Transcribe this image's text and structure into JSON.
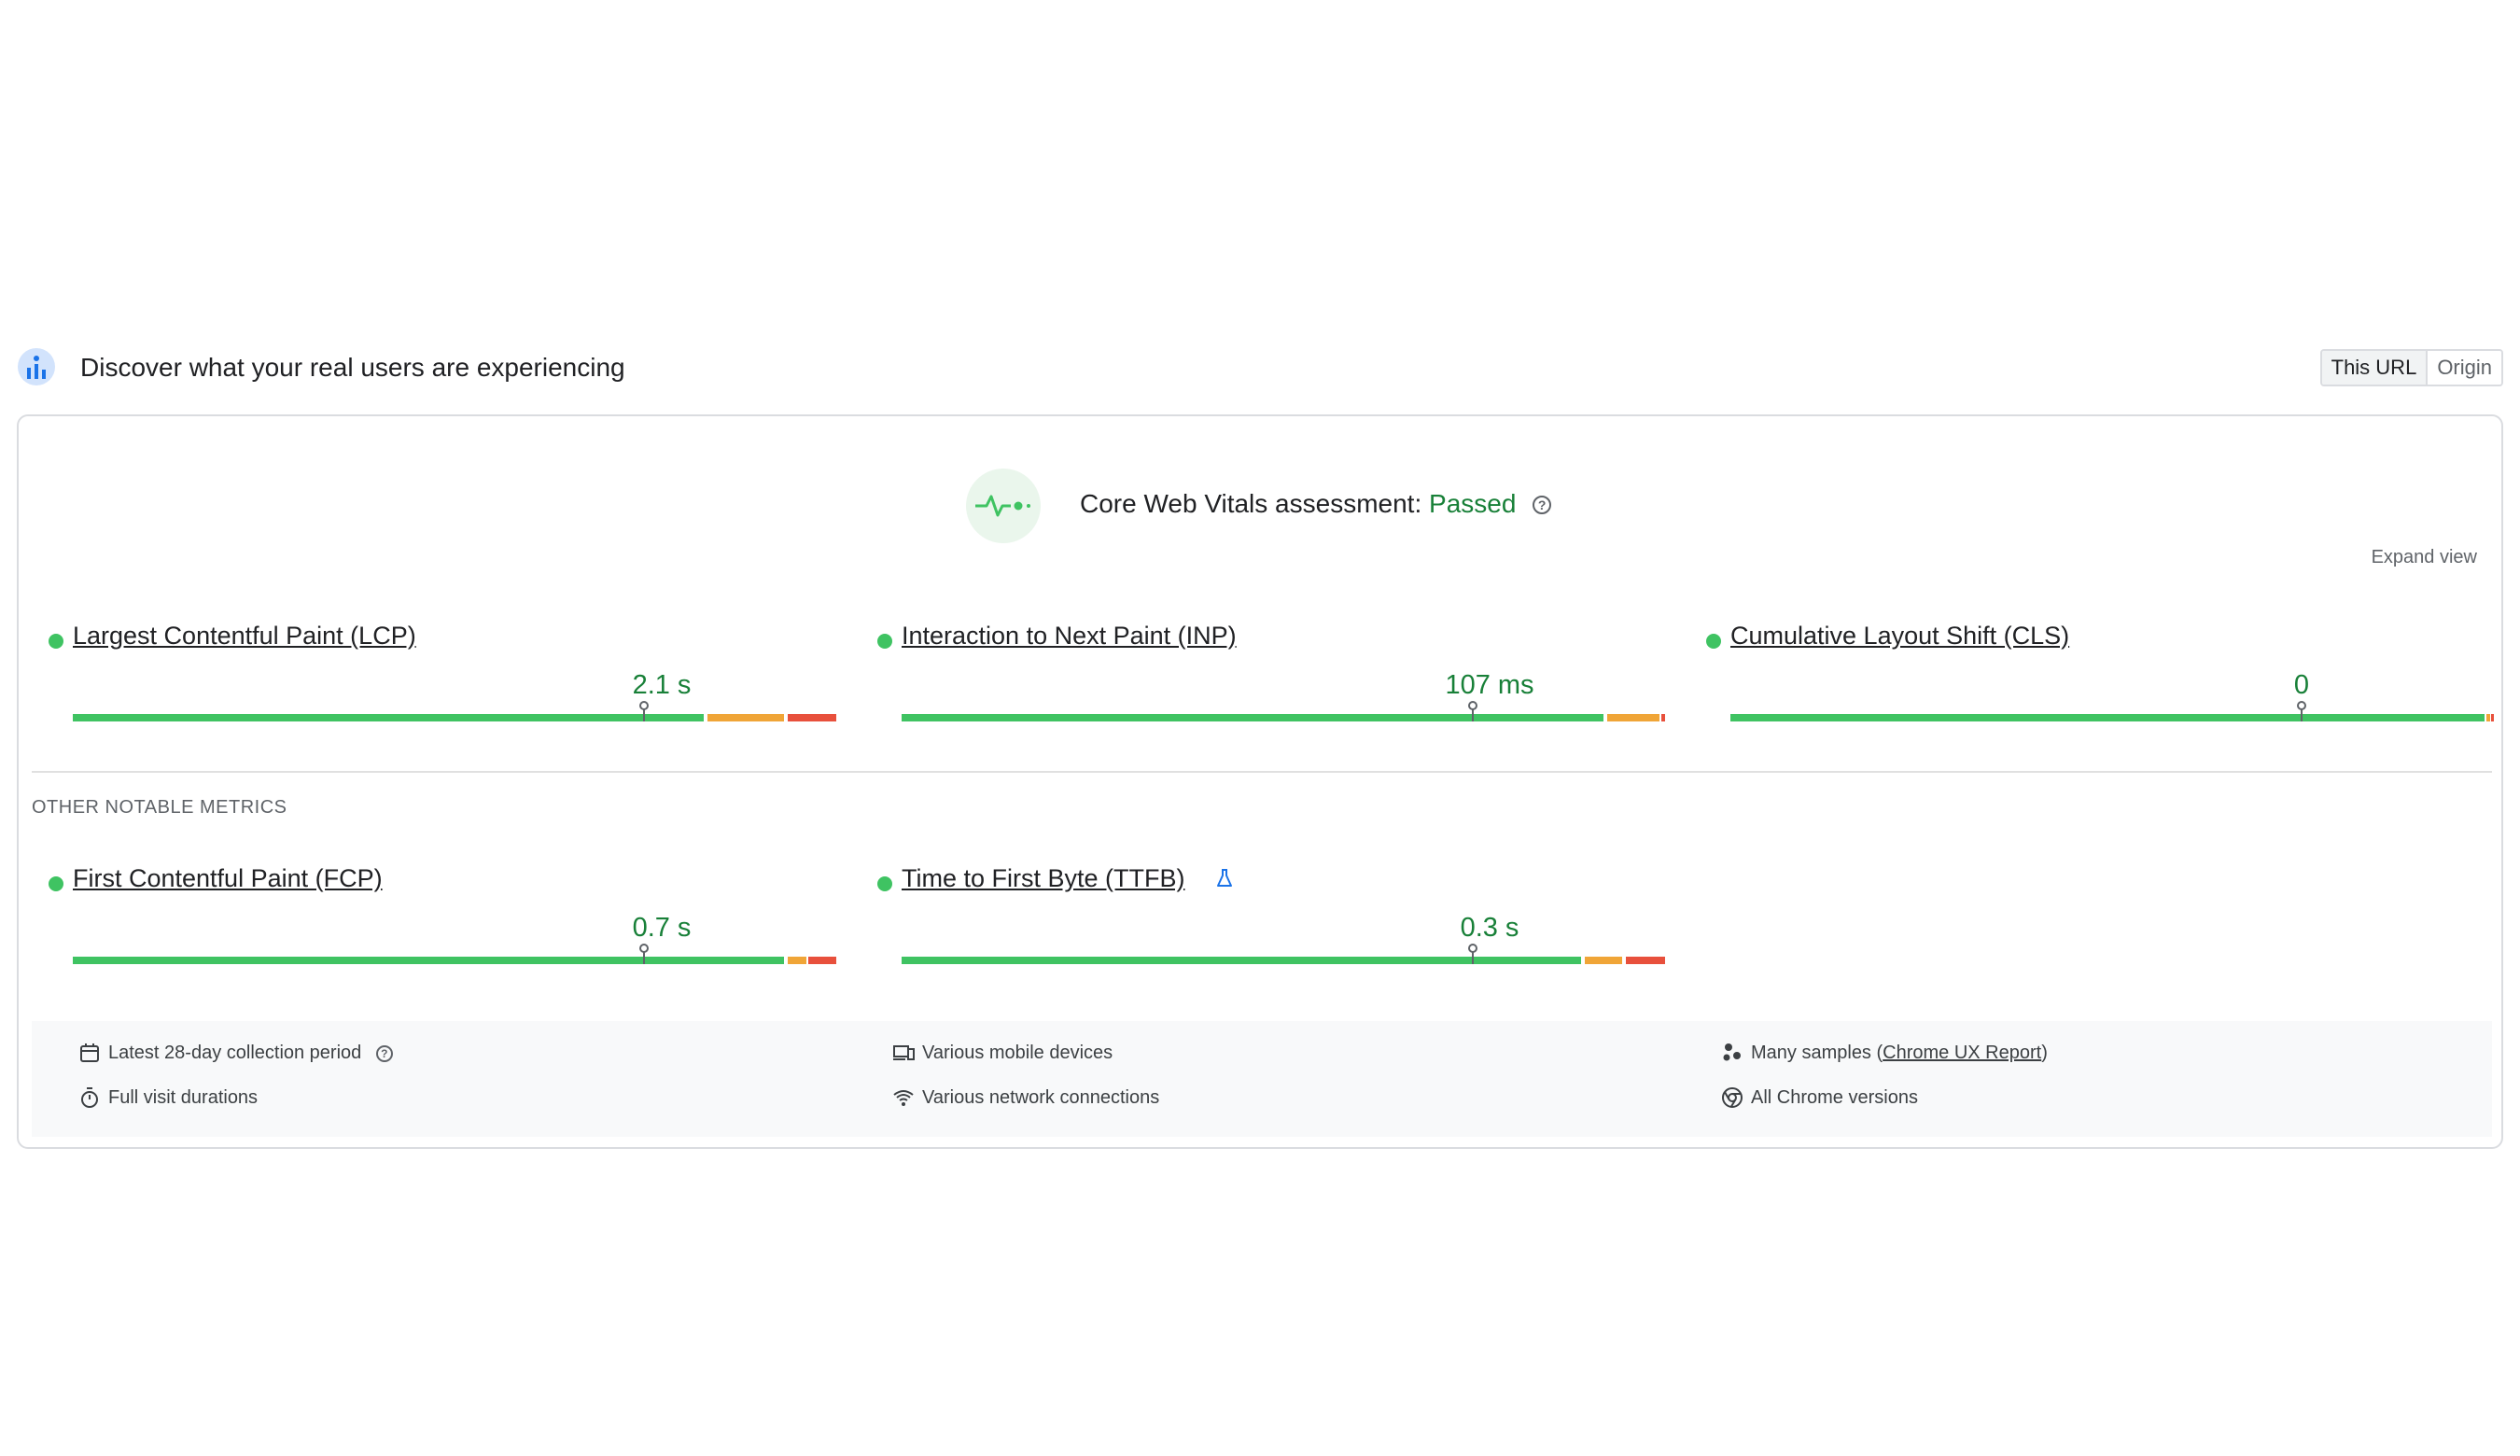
{
  "header": {
    "title": "Discover what your real users are experiencing",
    "toggle": {
      "this_url": "This URL",
      "origin": "Origin",
      "selected": "This URL"
    }
  },
  "assessment": {
    "label": "Core Web Vitals assessment:",
    "status": "Passed",
    "help": "?"
  },
  "expand_view": "Expand view",
  "core_metrics": [
    {
      "name": "Largest Contentful Paint (LCP)",
      "value": "2.1 s",
      "status_color": "#3fc362"
    },
    {
      "name": "Interaction to Next Paint (INP)",
      "value": "107 ms",
      "status_color": "#3fc362"
    },
    {
      "name": "Cumulative Layout Shift (CLS)",
      "value": "0",
      "status_color": "#3fc362"
    }
  ],
  "other_section_label": "OTHER NOTABLE METRICS",
  "other_metrics": [
    {
      "name": "First Contentful Paint (FCP)",
      "value": "0.7 s",
      "status_color": "#3fc362"
    },
    {
      "name": "Time to First Byte (TTFB)",
      "value": "0.3 s",
      "status_color": "#3fc362",
      "experimental_icon": "flask-icon"
    }
  ],
  "footer": {
    "period": "Latest 28-day collection period",
    "devices": "Various mobile devices",
    "samples_prefix": "Many samples (",
    "samples_link": "Chrome UX Report",
    "samples_suffix": ")",
    "durations": "Full visit durations",
    "network": "Various network connections",
    "versions": "All Chrome versions"
  },
  "colors": {
    "good": "#3fc362",
    "needs_improvement": "#f0a537",
    "poor": "#e8503c",
    "status_text": "#188038"
  }
}
